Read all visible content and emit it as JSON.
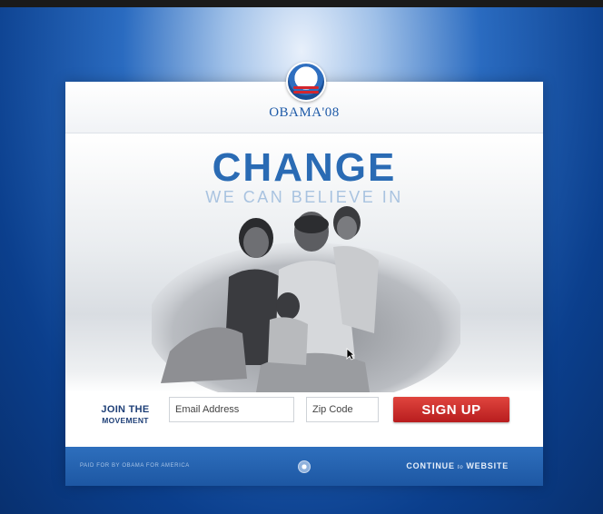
{
  "brand": {
    "name": "OBAMA'08"
  },
  "hero": {
    "headline": "CHANGE",
    "subline": "WE CAN BELIEVE IN"
  },
  "form": {
    "join_line1": "JOIN THE",
    "join_line2": "MOVEMENT",
    "email_placeholder": "Email Address",
    "zip_placeholder": "Zip Code",
    "signup_label": "SIGN UP"
  },
  "footer": {
    "paid_for": "PAID FOR BY OBAMA FOR AMERICA",
    "continue_word": "CONTINUE",
    "to_word": "to",
    "website_word": "WEBSITE"
  },
  "colors": {
    "brand_blue": "#2a6bb4",
    "signup_red": "#c8282a",
    "footer_blue": "#1d57a3"
  }
}
